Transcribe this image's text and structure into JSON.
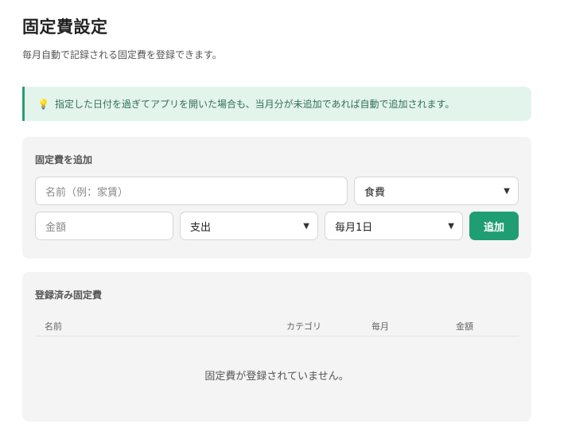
{
  "header": {
    "title": "固定費設定",
    "subtitle": "毎月自動で記録される固定費を登録できます。"
  },
  "info": {
    "icon": "lightbulb-icon",
    "text": "指定した日付を過ぎてアプリを開いた場合も、当月分が未追加であれば自動で追加されます。"
  },
  "add_form": {
    "heading": "固定費を追加",
    "name_placeholder": "名前（例：家賃）",
    "category_selected": "食費",
    "amount_placeholder": "金額",
    "type_selected": "支出",
    "day_selected": "毎月1日",
    "add_label": "追加"
  },
  "list": {
    "heading": "登録済み固定費",
    "columns": [
      "名前",
      "カテゴリ",
      "毎月",
      "金額"
    ],
    "empty_message": "固定費が登録されていません。"
  },
  "colors": {
    "accent": "#1f9e73",
    "info_bg": "#e3f4ed",
    "card_bg": "#f4f4f4"
  }
}
